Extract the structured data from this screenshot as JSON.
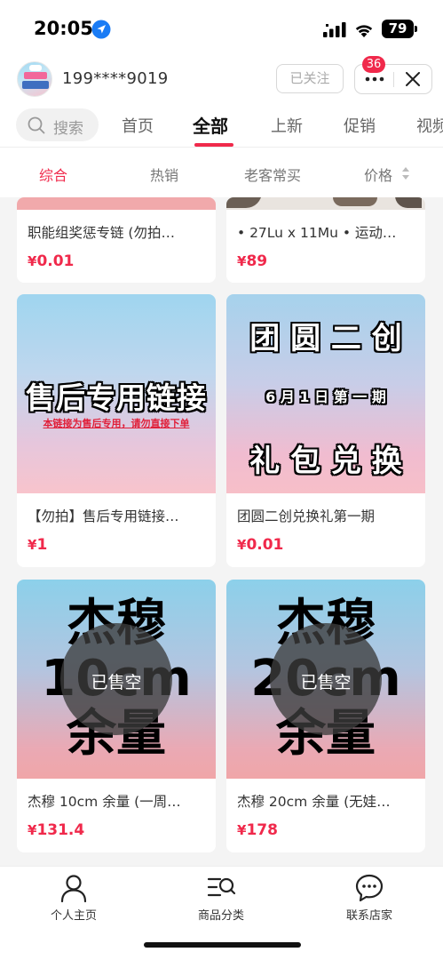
{
  "status_bar": {
    "time": "20:05",
    "battery": "79"
  },
  "shop": {
    "name": "199****9019",
    "follow_label": "已关注",
    "notification_count": "36"
  },
  "category_tabs": {
    "search_label": "搜索",
    "items": [
      {
        "label": "首页"
      },
      {
        "label": "全部"
      },
      {
        "label": "上新"
      },
      {
        "label": "促销"
      },
      {
        "label": "视频"
      }
    ]
  },
  "sort_bar": {
    "items": [
      {
        "label": "综合"
      },
      {
        "label": "热销"
      },
      {
        "label": "老客常买"
      },
      {
        "label": "价格"
      }
    ]
  },
  "products": [
    {
      "title": "职能组奖惩专链 (勿拍…",
      "price_symbol": "¥",
      "price": "0.01"
    },
    {
      "title": "• 27Lu x 11Mu • 运动…",
      "price_symbol": "¥",
      "price": "89"
    },
    {
      "title": "【勿拍】售后专用链接…",
      "price_symbol": "¥",
      "price": "1",
      "image_text": "售后专用链接",
      "image_subtext": "本链接为售后专用，请勿直接下单"
    },
    {
      "title": "团圆二创兑换礼第一期",
      "price_symbol": "¥",
      "price": "0.01",
      "image_line1": "团 圆 二 创",
      "image_line2": "6 月 1 日 第 一 期",
      "image_line3": "礼 包 兑 换"
    },
    {
      "title": "杰穆 10cm 余量 (一周…",
      "price_symbol": "¥",
      "price": "131.4",
      "image_line1": "杰穆",
      "image_line2": "10cm",
      "image_line3": "余量",
      "sold_out_label": "已售空"
    },
    {
      "title": "杰穆 20cm 余量 (无娃…",
      "price_symbol": "¥",
      "price": "178",
      "image_line1": "杰穆",
      "image_line2": "20cm",
      "image_line3": "余量",
      "sold_out_label": "已售空"
    }
  ],
  "bottom_nav": {
    "items": [
      {
        "label": "个人主页",
        "icon": "person-icon"
      },
      {
        "label": "商品分类",
        "icon": "category-search-icon"
      },
      {
        "label": "联系店家",
        "icon": "chat-icon"
      }
    ]
  },
  "colors": {
    "accent": "#f0294b"
  }
}
